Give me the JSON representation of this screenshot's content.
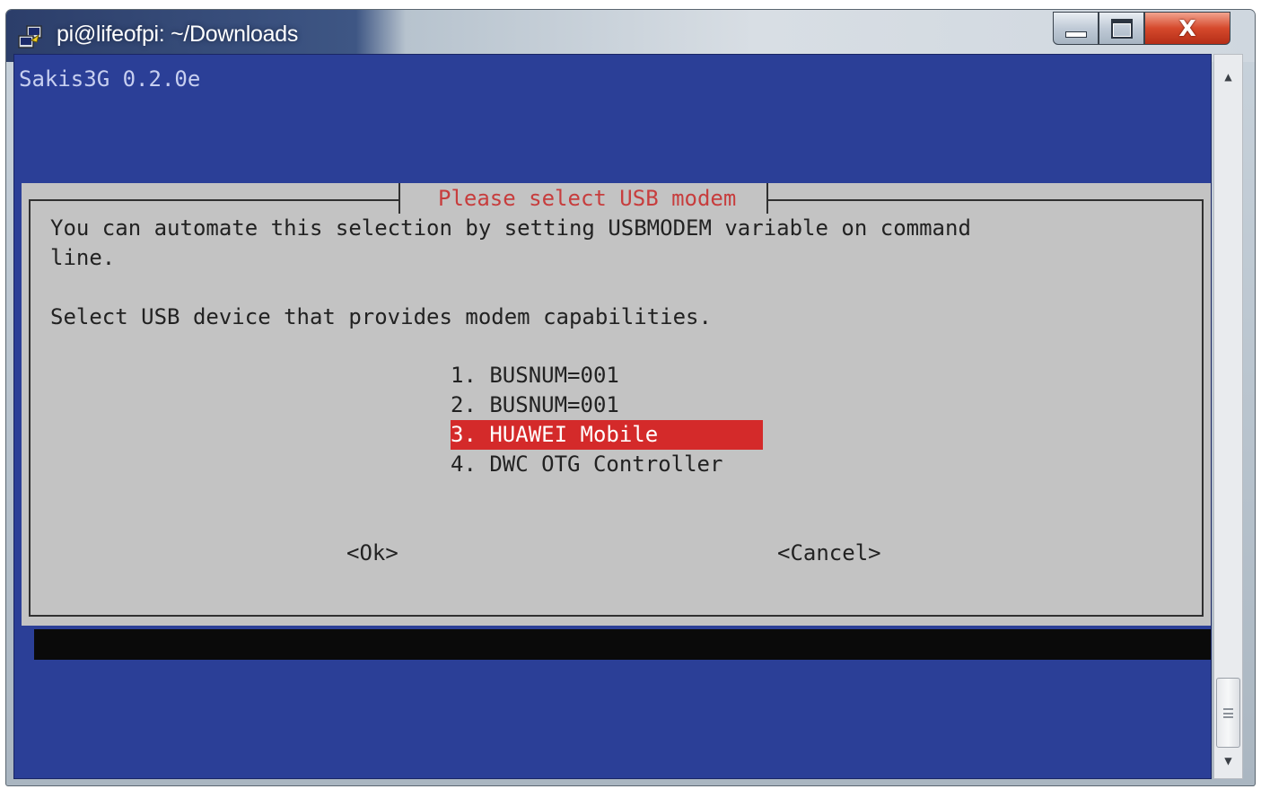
{
  "window": {
    "title": "pi@lifeofpi: ~/Downloads",
    "close_glyph": "X"
  },
  "terminal": {
    "header": "Sakis3G 0.2.0e"
  },
  "dialog": {
    "title": "Please select USB modem",
    "text_line1": "You can automate this selection by setting USBMODEM variable on command",
    "text_line2": "line.",
    "text_line3": "Select USB device that provides modem capabilities.",
    "items": [
      {
        "label": "1. BUSNUM=001"
      },
      {
        "label": "2. BUSNUM=001"
      },
      {
        "label": "3. HUAWEI Mobile"
      },
      {
        "label": "4. DWC OTG Controller"
      }
    ],
    "selected_index": 2,
    "ok_label": "<Ok>",
    "cancel_label": "<Cancel>"
  },
  "colors": {
    "terminal_bg": "#2b3f97",
    "dialog_bg": "#c3c3c3",
    "highlight": "#d42a2a",
    "title_red": "#c73d3d"
  },
  "icons": {
    "app": "putty-icon",
    "minimize": "minimize-icon",
    "maximize": "maximize-icon",
    "close": "close-icon",
    "scroll_up": "arrow-up-icon",
    "scroll_down": "arrow-down-icon"
  }
}
